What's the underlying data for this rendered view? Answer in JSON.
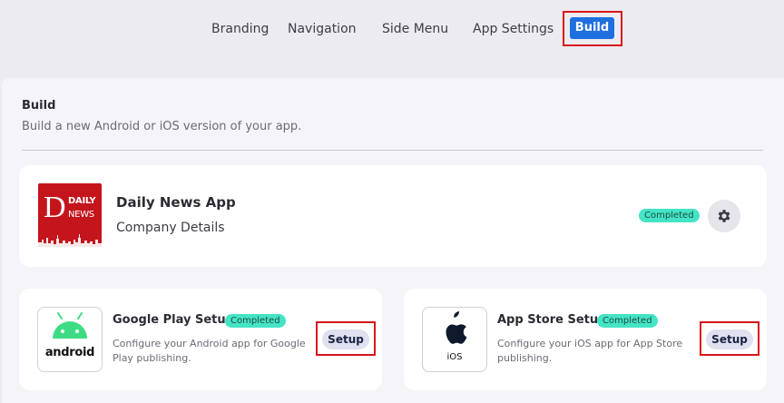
{
  "nav": {
    "tabs": [
      {
        "label": "Branding"
      },
      {
        "label": "Navigation"
      },
      {
        "label": "Side Menu"
      },
      {
        "label": "App Settings"
      },
      {
        "label": "Build",
        "active": true
      }
    ],
    "accent": "#1f6fe0",
    "highlight_color": "#d8141b"
  },
  "section": {
    "title": "Build",
    "subtitle": "Build a new Android or iOS version of your app."
  },
  "app": {
    "logo_letter": "D",
    "logo_word1": "DAILY",
    "logo_word2": "NEWS",
    "name": "Daily News App",
    "company": "Company Details",
    "status": "Completed",
    "settings_icon": "gear-icon"
  },
  "google_play": {
    "logo_text": "android",
    "title": "Google Play Setup",
    "status": "Completed",
    "description": "Configure your Android app for Google Play publishing.",
    "button_label": "Setup"
  },
  "app_store": {
    "logo_text": "iOS",
    "title": "App Store Setup",
    "status": "Completed",
    "description": "Configure your iOS app for App Store publishing.",
    "button_label": "Setup"
  },
  "colors": {
    "badge_bg": "#44e4c5",
    "logo_red": "#c4141c"
  }
}
